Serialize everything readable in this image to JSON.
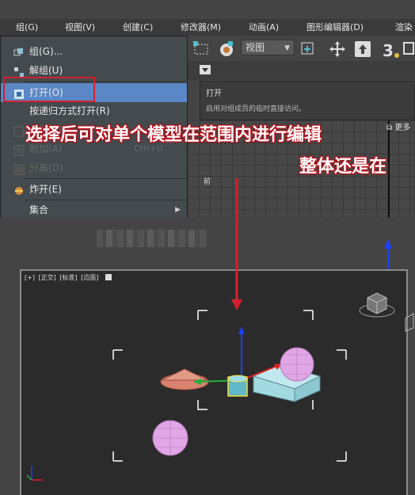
{
  "menubar": {
    "items": [
      {
        "label": "组(G)"
      },
      {
        "label": "视图(V)"
      },
      {
        "label": "创建(C)"
      },
      {
        "label": "修改器(M)"
      },
      {
        "label": "动画(A)"
      },
      {
        "label": "图形编辑器(D)"
      },
      {
        "label": "渲染"
      }
    ]
  },
  "group_menu": {
    "items": [
      {
        "label": "组(G)...",
        "icon": "group-icon",
        "state": "normal"
      },
      {
        "label": "解组(U)",
        "icon": "ungroup-icon",
        "state": "normal"
      },
      {
        "label": "打开(O)",
        "icon": "open-group-icon",
        "state": "selected"
      },
      {
        "label": "按递归方式打开(R)",
        "icon": "",
        "state": "normal"
      },
      {
        "label": "关闭(C)",
        "icon": "close-group-icon",
        "state": "disabled"
      },
      {
        "label": "附加(A)",
        "icon": "attach-icon",
        "state": "disabled",
        "shortcut": "Ctrl+U"
      },
      {
        "label": "分离(D)",
        "icon": "detach-icon",
        "state": "disabled"
      },
      {
        "label": "炸开(E)",
        "icon": "explode-icon",
        "state": "normal"
      },
      {
        "label": "集合",
        "icon": "",
        "state": "normal",
        "has_submenu": true
      }
    ]
  },
  "toolbar": {
    "view_dropdown": "视图",
    "number_badge": "3"
  },
  "tooltip": {
    "title": "打开",
    "description": "启用对组成员的临时直接访问。",
    "more_link": "更多"
  },
  "mini_viewport": {
    "label": "前"
  },
  "annotation": {
    "line1": "选择后可对单个模型在范围内进行编辑",
    "line2": "整体还是在",
    "color": "#d4202e"
  },
  "viewport": {
    "labels": [
      "[+]",
      "[正交]",
      "[标准]",
      "[边面]"
    ]
  },
  "colors": {
    "selected_bg": "#5b87c6",
    "highlight_red": "#d4202e",
    "sphere": "#e1a6e6",
    "cone": "#d8826f",
    "box": "#a3d9e0"
  }
}
